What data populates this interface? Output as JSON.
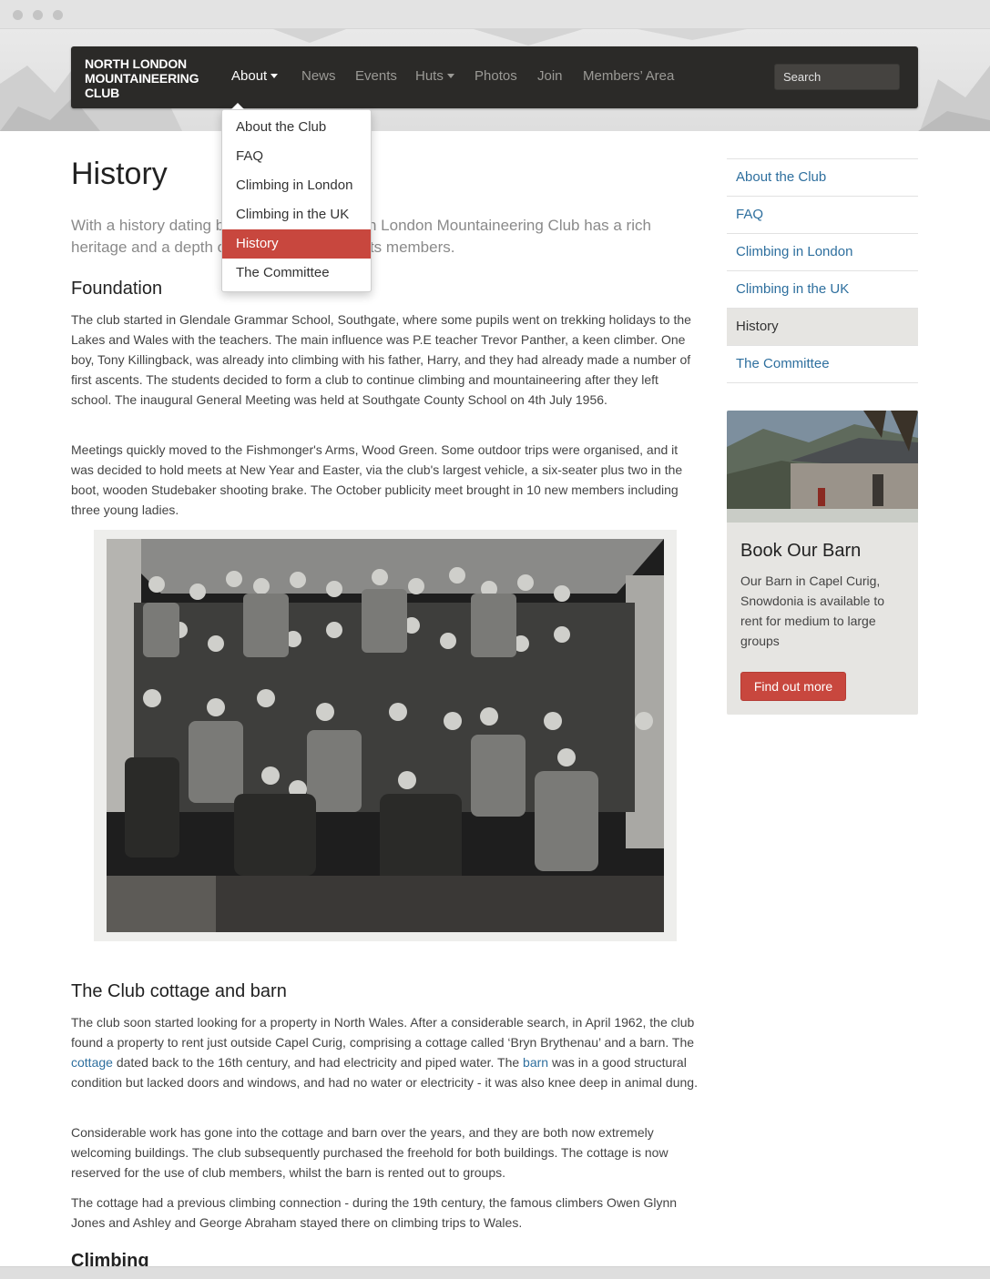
{
  "colors": {
    "accent": "#c8473e",
    "link": "#2e6f9e",
    "navbar": "#2b2a28"
  },
  "navbar": {
    "brand": "NORTH LONDON MOUNTAINEERING CLUB",
    "items": [
      {
        "label": "About",
        "has_caret": true,
        "active": true
      },
      {
        "label": "News"
      },
      {
        "label": "Events"
      },
      {
        "label": "Huts",
        "has_caret": true
      },
      {
        "label": "Photos"
      },
      {
        "label": "Join"
      },
      {
        "label": "Members’ Area"
      }
    ],
    "search_placeholder": "Search"
  },
  "dropdown": {
    "items": [
      "About the Club",
      "FAQ",
      "Climbing in London",
      "Climbing in the UK",
      "History",
      "The Committee"
    ],
    "active": "History"
  },
  "page": {
    "title": "History",
    "lead": "With a history dating back to 1956, the North London Mountaineering Club has a rich heritage and a depth of experience among its members.",
    "foundation_heading": "Foundation",
    "foundation_p1": "The club started in Glendale Grammar School, Southgate, where some pupils went on trekking holidays to the Lakes and  Wales with the teachers. The main influence was P.E teacher Trevor Panther, a keen climber. One boy, Tony Killingback, was already into climbing with his father, Harry, and they had already made a number of first ascents. The students decided to form a club to continue climbing and mountaineering after they left school. The inaugural General Meeting was held at Southgate County School on 4th July 1956.",
    "foundation_p2": "Meetings quickly moved to the Fishmonger's Arms, Wood Green. Some outdoor trips were organised, and it was decided to hold meets at New Year and Easter, via the club's largest vehicle, a six-seater plus two in the boot, wooden Studebaker shooting brake. The October publicity meet brought in 10 new members including three young ladies.",
    "cottage_heading": "The Club cottage and barn",
    "cottage_p1": {
      "text_1": "The club soon started looking for a property in North Wales. After a considerable search, in April 1962, the club found a property to rent just outside Capel Curig, comprising a cottage called ‘Bryn Brythenau’ and a barn. The ",
      "link_1": "cottage",
      "text_2": " dated back to the 16th century, and had electricity and piped water.  The ",
      "link_2": "barn",
      "text_3": " was in a good structural condition but lacked doors and windows, and had no water or electricity - it was also knee deep in animal dung."
    },
    "cottage_p2": "Considerable work has gone into the cottage and barn over the years, and they are both now extremely welcoming buildings. The club subsequently purchased the freehold for both buildings. The cottage is now reserved for the use of club members, whilst the barn is rented out to groups.",
    "cottage_p3": "The cottage had a previous climbing connection - during the 19th century, the famous climbers Owen Glynn Jones and Ashley and George Abraham stayed there on climbing trips to Wales.",
    "climbing_heading": "Climbing"
  },
  "sidebar": {
    "items": [
      "About the Club",
      "FAQ",
      "Climbing in London",
      "Climbing in the UK",
      "History",
      "The Committee"
    ],
    "active": "History"
  },
  "barn_card": {
    "title": "Book Our Barn",
    "text": "Our Barn in Capel Curig, Snowdonia is available to rent for medium to large groups",
    "button": "Find out more"
  }
}
